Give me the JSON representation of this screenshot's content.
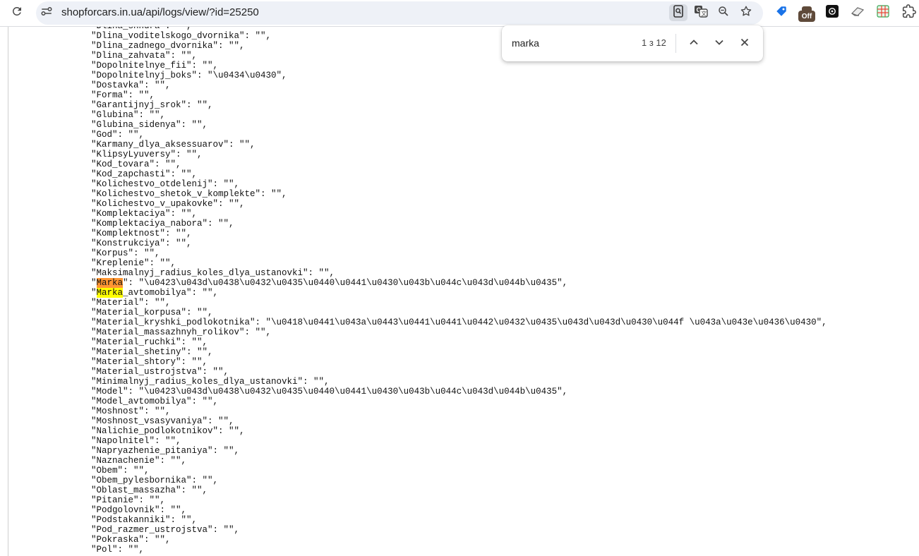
{
  "browser": {
    "url": "shopforcars.in.ua/api/logs/view/?id=25250",
    "extension_badge": "Off",
    "toolbar_icons": [
      "reload-icon",
      "site-info-icon",
      "find-in-page-icon",
      "translate-icon",
      "zoom-icon",
      "bookmark-star-icon",
      "extension-icons",
      "extensions-puzzle-icon"
    ]
  },
  "find_bar": {
    "query": "marka",
    "count": "1 з 12"
  },
  "highlight": {
    "current": "#ff9632",
    "other": "#ffff00"
  },
  "log_lines": [
    [
      "\"Dlina_shnura\": \"\","
    ],
    [
      "\"Dlina_voditelskogo_dvornika\": \"\","
    ],
    [
      "\"Dlina_zadnego_dvornika\": \"\","
    ],
    [
      "\"Dlina_zahvata\": \"\","
    ],
    [
      "\"Dopolnitelnye_fii\": \"\","
    ],
    [
      "\"Dopolnitelnyj_boks\": \"\\u0434\\u0430\","
    ],
    [
      "\"Dostavka\": \"\","
    ],
    [
      "\"Forma\": \"\","
    ],
    [
      "\"Garantijnyj_srok\": \"\","
    ],
    [
      "\"Glubina\": \"\","
    ],
    [
      "\"Glubina_sidenya\": \"\","
    ],
    [
      "\"God\": \"\","
    ],
    [
      "\"Karmany_dlya_aksessuarov\": \"\","
    ],
    [
      "\"KlipsyLyuversy\": \"\","
    ],
    [
      "\"Kod_tovara\": \"\","
    ],
    [
      "\"Kod_zapchasti\": \"\","
    ],
    [
      "\"Kolichestvo_otdelenij\": \"\","
    ],
    [
      "\"Kolichestvo_shetok_v_komplekte\": \"\","
    ],
    [
      "\"Kolichestvo_v_upakovke\": \"\","
    ],
    [
      "\"Komplektaciya\": \"\","
    ],
    [
      "\"Komplektaciya_nabora\": \"\","
    ],
    [
      "\"Komplektnost\": \"\","
    ],
    [
      "\"Konstrukciya\": \"\","
    ],
    [
      "\"Korpus\": \"\","
    ],
    [
      "\"Kreplenie\": \"\","
    ],
    [
      "\"Maksimalnyj_radius_koles_dlya_ustanovki\": \"\","
    ],
    [
      "\"",
      "Marka",
      "\": \"\\u0423\\u043d\\u0438\\u0432\\u0435\\u0440\\u0441\\u0430\\u043b\\u044c\\u043d\\u044b\\u0435\","
    ],
    [
      "\"",
      "Marka",
      "_avtomobilya\": \"\","
    ],
    [
      "\"Material\": \"\","
    ],
    [
      "\"Material_korpusa\": \"\","
    ],
    [
      "\"Material_kryshki_podlokotnika\": \"\\u0418\\u0441\\u043a\\u0443\\u0441\\u0441\\u0442\\u0432\\u0435\\u043d\\u043d\\u0430\\u044f \\u043a\\u043e\\u0436\\u0430\","
    ],
    [
      "\"Material_massazhnyh_rolikov\": \"\","
    ],
    [
      "\"Material_ruchki\": \"\","
    ],
    [
      "\"Material_shetiny\": \"\","
    ],
    [
      "\"Material_shtory\": \"\","
    ],
    [
      "\"Material_ustrojstva\": \"\","
    ],
    [
      "\"Minimalnyj_radius_koles_dlya_ustanovki\": \"\","
    ],
    [
      "\"Model\": \"\\u0423\\u043d\\u0438\\u0432\\u0435\\u0440\\u0441\\u0430\\u043b\\u044c\\u043d\\u044b\\u0435\","
    ],
    [
      "\"Model_avtomobilya\": \"\","
    ],
    [
      "\"Moshnost\": \"\","
    ],
    [
      "\"Moshnost_vsasyvaniya\": \"\","
    ],
    [
      "\"Nalichie_podlokotnikov\": \"\","
    ],
    [
      "\"Napolnitel\": \"\","
    ],
    [
      "\"Napryazhenie_pitaniya\": \"\","
    ],
    [
      "\"Naznachenie\": \"\","
    ],
    [
      "\"Obem\": \"\","
    ],
    [
      "\"Obem_pylesbornika\": \"\","
    ],
    [
      "\"Oblast_massazha\": \"\","
    ],
    [
      "\"Pitanie\": \"\","
    ],
    [
      "\"Podgolovnik\": \"\","
    ],
    [
      "\"Podstakanniki\": \"\","
    ],
    [
      "\"Pod_razmer_ustrojstva\": \"\","
    ],
    [
      "\"Pokraska\": \"\","
    ],
    [
      "\"Pol\": \"\","
    ]
  ]
}
